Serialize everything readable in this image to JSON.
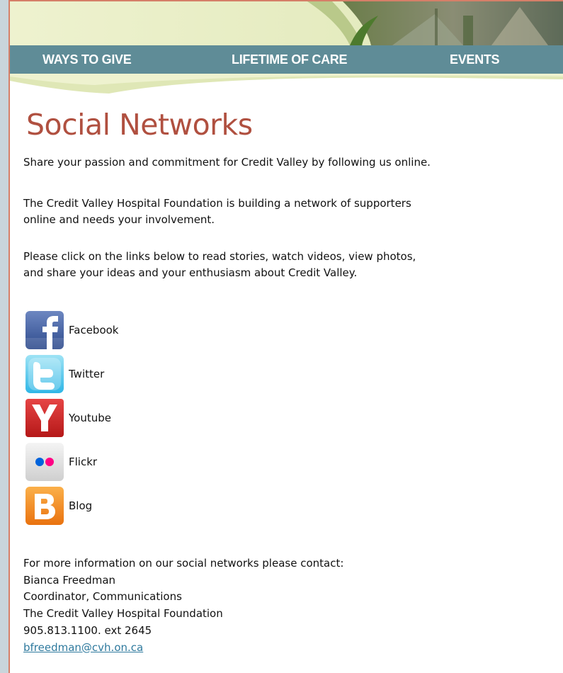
{
  "nav": {
    "items": [
      "WAYS TO GIVE",
      "LIFETIME OF CARE",
      "EVENTS"
    ]
  },
  "page": {
    "title": "Social Networks",
    "intro": "Share your passion and commitment for Credit Valley by following us online.",
    "para1": [
      "The Credit Valley Hospital Foundation is building a network of supporters",
      "online and needs your involvement."
    ],
    "para2": [
      "Please click on the links below to read stories, watch videos, view photos,",
      "and share your ideas and your enthusiasm about Credit Valley."
    ]
  },
  "social": [
    {
      "label": "Facebook",
      "icon": "facebook-icon",
      "color": "#3b5998"
    },
    {
      "label": "Twitter",
      "icon": "twitter-icon",
      "color": "#33ccff"
    },
    {
      "label": "Youtube",
      "icon": "youtube-icon",
      "color": "#cc2222"
    },
    {
      "label": "Flickr",
      "icon": "flickr-icon",
      "color": "#ff0084"
    },
    {
      "label": "Blog",
      "icon": "blogger-icon",
      "color": "#f57d00"
    }
  ],
  "contact": {
    "intro": "For more information on our social networks please contact:",
    "name": "Bianca Freedman",
    "role": "Coordinator, Communications",
    "org": "The Credit Valley Hospital Foundation",
    "phone": "905.813.1100. ext  2645",
    "email": "bfreedman@cvh.on.ca"
  },
  "colors": {
    "nav_bar": "#5f8c97",
    "title": "#b05040",
    "link": "#2f7a9e",
    "accent_border": "#d57f68"
  }
}
